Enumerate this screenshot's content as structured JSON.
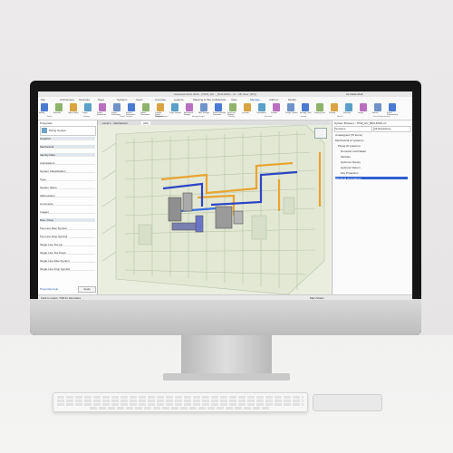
{
  "window_title": "Autodesk Revit 2024 - [TGW_HC..._BUILDING...rvt - 3D View: {3D}]",
  "user": "AL.KEALOHA",
  "ribbon_tabs": [
    "File",
    "Architecture",
    "Structure",
    "Steel",
    "Systems",
    "Insert",
    "Annotate",
    "Analyze",
    "Massing & Site",
    "Collaborate",
    "View",
    "Manage",
    "Add-Ins",
    "Modify"
  ],
  "ribbon_buttons": [
    "Modify",
    "Materials",
    "Object Styles",
    "Snaps",
    "Project Information",
    "Project Parameters",
    "Shared Parameters",
    "Global Parameters",
    "Transfer Project Standards",
    "Purge Unused",
    "Mechanical Settings",
    "MEP Settings",
    "Panel Schedule Templates",
    "Structural Settings",
    "Location",
    "Coordinates",
    "Position",
    "Design Options",
    "Manage Links",
    "Starting View",
    "Phasing",
    "Selection",
    "Inquiry",
    "Macros",
    "Visual Programming"
  ],
  "ribbon_groups": [
    "Select",
    "Settings",
    "Project Location",
    "Design Options",
    "Manage Project",
    "Phasing",
    "Selection",
    "Inquiry",
    "Macros",
    "Visual Programming"
  ],
  "properties": {
    "title": "Properties",
    "type": "Piping System",
    "rows": [
      "Graphics",
      "Mechanical",
      "Identity Data",
      "Calculations",
      "System Classification",
      "Type",
      "System Name",
      "Abbreviation",
      "Comments",
      "Images",
      "Rise / Drop",
      "Two Line Rise Symbol",
      "Two Line Drop Symbol",
      "Single Line Tee Up",
      "Single Line Tee Down",
      "Single Line Rise Symbol",
      "Single Line Drop Symbol"
    ],
    "help_link": "Properties help",
    "apply_button": "Apply"
  },
  "view_tabs": [
    "Level 1 - Mechanical",
    "{3D}"
  ],
  "browser": {
    "title": "System Browser - TGW_HC_BUILDING.rvt",
    "filter": "Systems",
    "view_mode": "All Disciplines",
    "items": [
      "Unassigned (76 items)",
      "Mechanical (2 systems)",
      "Piping (8 systems)",
      "Domestic Cold Water",
      "Sanitary",
      "Hydronic Supply",
      "Hydronic Return",
      "Fire Protection",
      "Electrical (0 systems)"
    ]
  },
  "statusbar": {
    "left": "Click to select, TAB for alternates",
    "right": "Main Model"
  }
}
